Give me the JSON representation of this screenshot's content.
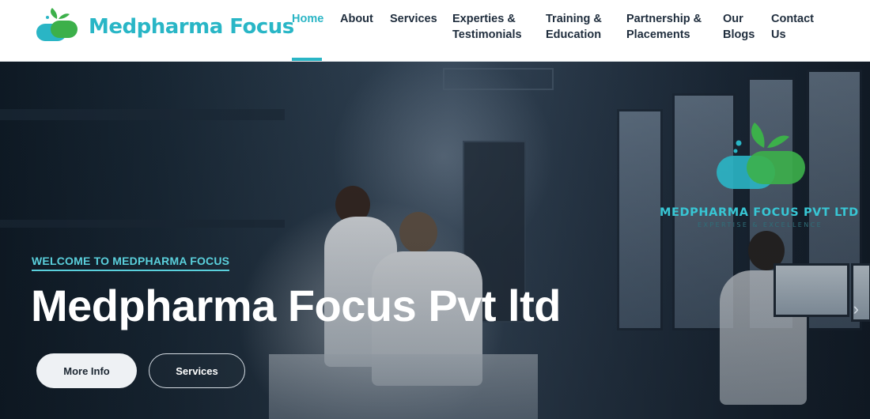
{
  "brand": {
    "name": "Medpharma Focus",
    "colors": {
      "primary": "#2ab5c5",
      "green": "#3cb04a",
      "dark": "#1f2d3d"
    }
  },
  "nav": {
    "items": [
      {
        "label": "Home",
        "active": true
      },
      {
        "label": "About"
      },
      {
        "label": "Services"
      },
      {
        "label": "Experties &\nTestimonials"
      },
      {
        "label": "Training &\nEducation"
      },
      {
        "label": "Partnership &\nPlacements"
      },
      {
        "label": "Our\nBlogs"
      },
      {
        "label": "Contact\nUs"
      }
    ]
  },
  "hero": {
    "welcome": "WELCOME TO MEDPHARMA FOCUS",
    "title": "Medpharma Focus Pvt ltd",
    "buttons": {
      "primary": "More Info",
      "secondary": "Services"
    },
    "watermark": {
      "title": "MEDPHARMA FOCUS PVT LTD",
      "tagline": "EXPERTISE & EXCELLENCE"
    },
    "next_icon": "chevron-right-icon"
  }
}
